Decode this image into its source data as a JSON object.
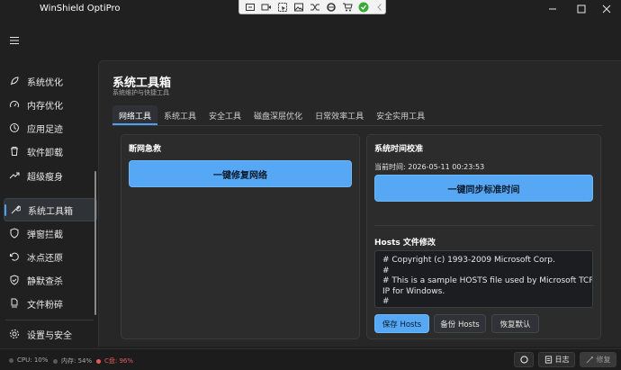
{
  "app": {
    "title": "WinShield OptiPro"
  },
  "float_toolbar": {
    "icons": [
      "screenshot-icon",
      "video-icon",
      "cursor-select-icon",
      "image-icon",
      "shuffle-icon",
      "ring-icon",
      "cart-icon",
      "check-circle-icon",
      "chevron-left-icon"
    ],
    "accent": "#3aa93a"
  },
  "sidebar": {
    "items": [
      {
        "label": "系统优化",
        "icon": "rocket-icon"
      },
      {
        "label": "内存优化",
        "icon": "gauge-icon"
      },
      {
        "label": "应用足迹",
        "icon": "footprint-icon"
      },
      {
        "label": "软件卸载",
        "icon": "trash-icon"
      },
      {
        "label": "超级瘦身",
        "icon": "trend-icon"
      },
      {
        "label": "系统工具箱",
        "icon": "wrench-icon",
        "active": true
      },
      {
        "label": "弹窗拦截",
        "icon": "shield-icon"
      },
      {
        "label": "冰点还原",
        "icon": "restore-icon"
      },
      {
        "label": "静默查杀",
        "icon": "shield-check-icon"
      },
      {
        "label": "文件粉碎",
        "icon": "file-shred-icon"
      }
    ],
    "settings": {
      "label": "设置与安全",
      "icon": "gear-icon"
    }
  },
  "page": {
    "title": "系统工具箱",
    "subtitle": "系统维护与快捷工具",
    "tabs": [
      "网络工具",
      "系统工具",
      "安全工具",
      "磁盘深层优化",
      "日常效率工具",
      "安全实用工具"
    ],
    "active_tab": 0
  },
  "left_card": {
    "title": "断网急救",
    "button": "一键修复网络"
  },
  "right_card": {
    "title": "系统时间校准",
    "current_time_label": "当前时间: 2026-05-11 00:23:53",
    "sync_button": "一键同步标准时间",
    "hosts_title": "Hosts 文件修改",
    "hosts_content": "# Copyright (c) 1993-2009 Microsoft Corp.\n#\n# This is a sample HOSTS file used by Microsoft TCP/\nIP for Windows.\n#",
    "save_button": "保存 Hosts",
    "backup_button": "备份 Hosts",
    "restore_button": "恢复默认"
  },
  "statusbar": {
    "cpu": "CPU: 10%",
    "memory": "内存: 54%",
    "disk": "C盘: 96%",
    "log_button": "日志",
    "repair_button": "修复"
  },
  "colors": {
    "accent": "#56a8f5",
    "warn": "#e25c5c",
    "background": "#202020"
  }
}
